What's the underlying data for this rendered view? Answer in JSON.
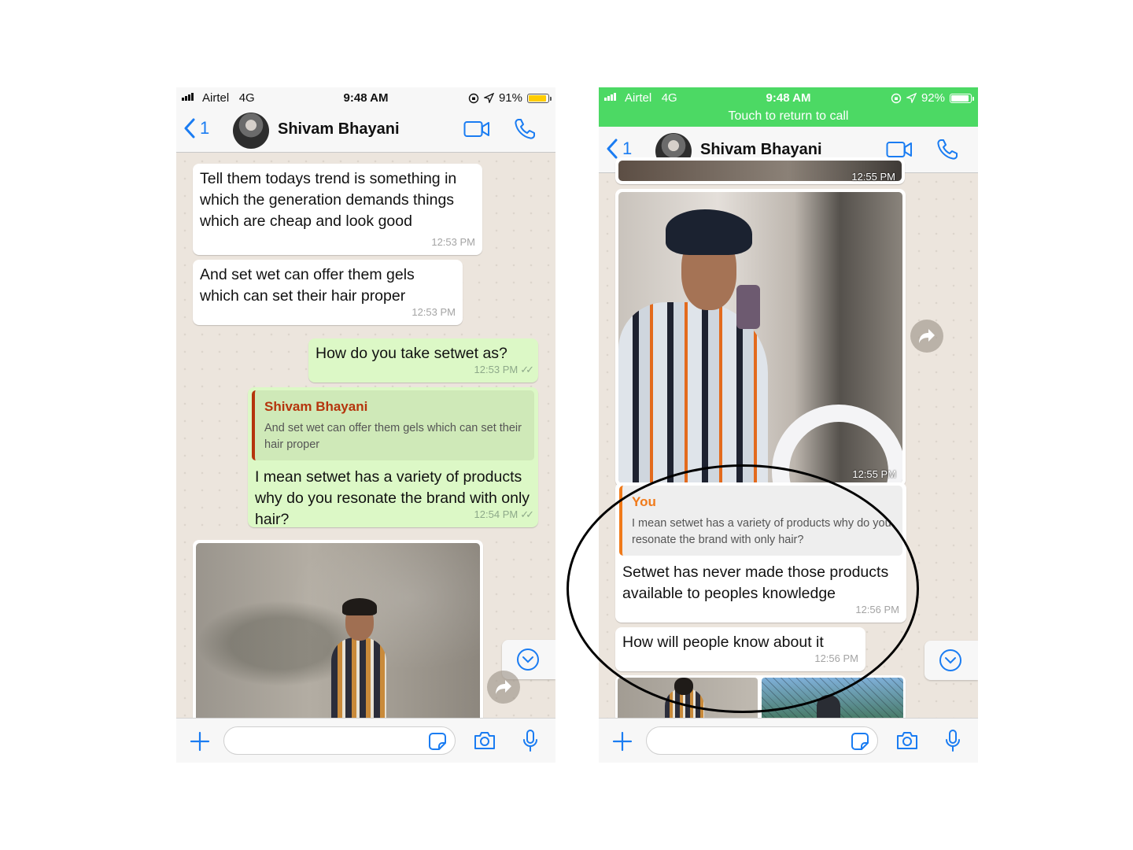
{
  "left": {
    "status": {
      "carrier": "Airtel",
      "network": "4G",
      "time": "9:48 AM",
      "battery": "91%",
      "battery_level": 0.91
    },
    "header": {
      "back_count": "1",
      "contact_name": "Shivam Bhayani"
    },
    "messages": [
      {
        "text": "Tell them todays trend is something in which the generation demands things which are cheap and look good",
        "time": "12:53 PM"
      },
      {
        "text": "And set wet can offer them gels which can set their hair proper",
        "time": "12:53 PM"
      },
      {
        "text": "How do you take setwet as?",
        "time": "12:53 PM"
      },
      {
        "quote_author": "Shivam Bhayani",
        "quote_text": "And set wet can offer them gels which can set their hair proper",
        "text": "I mean setwet has a variety of products why do you resonate the brand with only hair?",
        "time": "12:54 PM"
      }
    ],
    "ticks": "✓✓"
  },
  "right": {
    "status": {
      "carrier": "Airtel",
      "network": "4G",
      "time": "9:48 AM",
      "battery": "92%",
      "battery_level": 0.92
    },
    "return_call": "Touch to return to call",
    "header": {
      "back_count": "1",
      "contact_name": "Shivam Bhayani"
    },
    "partial_time": "12:55 PM",
    "photo_time": "12:55 PM",
    "messages": [
      {
        "quote_author": "You",
        "quote_text": "I mean setwet has a variety of products why do you resonate the brand with only hair?",
        "text": "Setwet has never made those products available to peoples knowledge",
        "time": "12:56 PM"
      },
      {
        "text": "How will people know about it",
        "time": "12:56 PM"
      }
    ]
  },
  "colors": {
    "accent_blue": "#1a7cf2",
    "outgoing_bubble": "#dcf8c6",
    "incoming_bubble": "#ffffff",
    "call_bar_green": "#4cd964",
    "quote_author_dark_orange": "#b5340c",
    "quote_author_orange": "#f07a1a",
    "battery_yellow": "#ffcc00"
  }
}
